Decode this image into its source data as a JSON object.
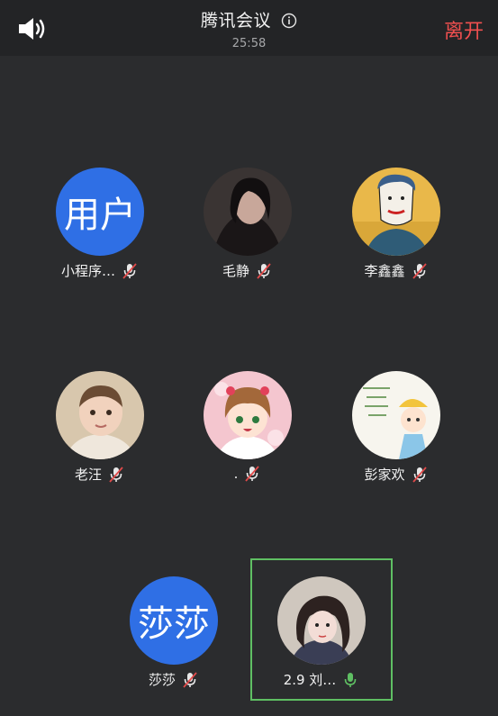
{
  "header": {
    "title": "腾讯会议",
    "timer": "25:58",
    "leave_label": "离开"
  },
  "participants": [
    {
      "name": "小程序…",
      "avatar_text": "用户",
      "avatar_type": "text",
      "mic": "muted"
    },
    {
      "name": "毛静",
      "avatar_type": "photo",
      "mic": "muted"
    },
    {
      "name": "李鑫鑫",
      "avatar_type": "illustration",
      "mic": "muted"
    },
    {
      "name": "老汪",
      "avatar_type": "photo",
      "mic": "muted"
    },
    {
      "name": ".",
      "avatar_type": "illustration",
      "mic": "muted"
    },
    {
      "name": "彭家欢",
      "avatar_type": "illustration",
      "mic": "muted"
    },
    {
      "name": "莎莎",
      "avatar_text": "莎莎",
      "avatar_type": "text",
      "mic": "muted"
    },
    {
      "name": "2.9 刘…",
      "avatar_type": "illustration",
      "mic": "active"
    }
  ],
  "colors": {
    "background": "#2b2c2e",
    "header": "#232426",
    "avatar_blue": "#2f6fe5",
    "leave_red": "#ef4f4f",
    "active_green": "#5fbf63"
  }
}
